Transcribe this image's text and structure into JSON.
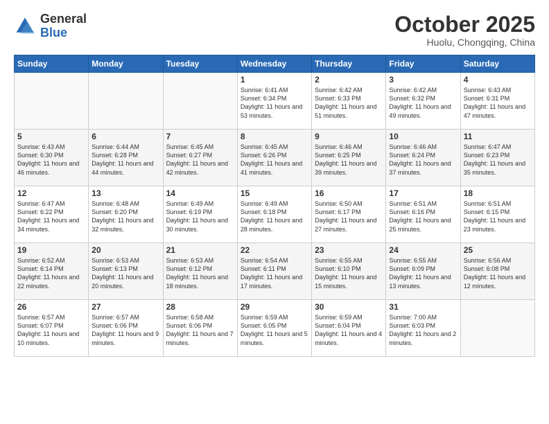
{
  "header": {
    "logo_general": "General",
    "logo_blue": "Blue",
    "month": "October 2025",
    "location": "Huolu, Chongqing, China"
  },
  "days_of_week": [
    "Sunday",
    "Monday",
    "Tuesday",
    "Wednesday",
    "Thursday",
    "Friday",
    "Saturday"
  ],
  "weeks": [
    [
      {
        "day": "",
        "info": ""
      },
      {
        "day": "",
        "info": ""
      },
      {
        "day": "",
        "info": ""
      },
      {
        "day": "1",
        "info": "Sunrise: 6:41 AM\nSunset: 6:34 PM\nDaylight: 11 hours and 53 minutes."
      },
      {
        "day": "2",
        "info": "Sunrise: 6:42 AM\nSunset: 6:33 PM\nDaylight: 11 hours and 51 minutes."
      },
      {
        "day": "3",
        "info": "Sunrise: 6:42 AM\nSunset: 6:32 PM\nDaylight: 11 hours and 49 minutes."
      },
      {
        "day": "4",
        "info": "Sunrise: 6:43 AM\nSunset: 6:31 PM\nDaylight: 11 hours and 47 minutes."
      }
    ],
    [
      {
        "day": "5",
        "info": "Sunrise: 6:43 AM\nSunset: 6:30 PM\nDaylight: 11 hours and 46 minutes."
      },
      {
        "day": "6",
        "info": "Sunrise: 6:44 AM\nSunset: 6:28 PM\nDaylight: 11 hours and 44 minutes."
      },
      {
        "day": "7",
        "info": "Sunrise: 6:45 AM\nSunset: 6:27 PM\nDaylight: 11 hours and 42 minutes."
      },
      {
        "day": "8",
        "info": "Sunrise: 6:45 AM\nSunset: 6:26 PM\nDaylight: 11 hours and 41 minutes."
      },
      {
        "day": "9",
        "info": "Sunrise: 6:46 AM\nSunset: 6:25 PM\nDaylight: 11 hours and 39 minutes."
      },
      {
        "day": "10",
        "info": "Sunrise: 6:46 AM\nSunset: 6:24 PM\nDaylight: 11 hours and 37 minutes."
      },
      {
        "day": "11",
        "info": "Sunrise: 6:47 AM\nSunset: 6:23 PM\nDaylight: 11 hours and 35 minutes."
      }
    ],
    [
      {
        "day": "12",
        "info": "Sunrise: 6:47 AM\nSunset: 6:22 PM\nDaylight: 11 hours and 34 minutes."
      },
      {
        "day": "13",
        "info": "Sunrise: 6:48 AM\nSunset: 6:20 PM\nDaylight: 11 hours and 32 minutes."
      },
      {
        "day": "14",
        "info": "Sunrise: 6:49 AM\nSunset: 6:19 PM\nDaylight: 11 hours and 30 minutes."
      },
      {
        "day": "15",
        "info": "Sunrise: 6:49 AM\nSunset: 6:18 PM\nDaylight: 11 hours and 28 minutes."
      },
      {
        "day": "16",
        "info": "Sunrise: 6:50 AM\nSunset: 6:17 PM\nDaylight: 11 hours and 27 minutes."
      },
      {
        "day": "17",
        "info": "Sunrise: 6:51 AM\nSunset: 6:16 PM\nDaylight: 11 hours and 25 minutes."
      },
      {
        "day": "18",
        "info": "Sunrise: 6:51 AM\nSunset: 6:15 PM\nDaylight: 11 hours and 23 minutes."
      }
    ],
    [
      {
        "day": "19",
        "info": "Sunrise: 6:52 AM\nSunset: 6:14 PM\nDaylight: 11 hours and 22 minutes."
      },
      {
        "day": "20",
        "info": "Sunrise: 6:53 AM\nSunset: 6:13 PM\nDaylight: 11 hours and 20 minutes."
      },
      {
        "day": "21",
        "info": "Sunrise: 6:53 AM\nSunset: 6:12 PM\nDaylight: 11 hours and 18 minutes."
      },
      {
        "day": "22",
        "info": "Sunrise: 6:54 AM\nSunset: 6:11 PM\nDaylight: 11 hours and 17 minutes."
      },
      {
        "day": "23",
        "info": "Sunrise: 6:55 AM\nSunset: 6:10 PM\nDaylight: 11 hours and 15 minutes."
      },
      {
        "day": "24",
        "info": "Sunrise: 6:55 AM\nSunset: 6:09 PM\nDaylight: 11 hours and 13 minutes."
      },
      {
        "day": "25",
        "info": "Sunrise: 6:56 AM\nSunset: 6:08 PM\nDaylight: 11 hours and 12 minutes."
      }
    ],
    [
      {
        "day": "26",
        "info": "Sunrise: 6:57 AM\nSunset: 6:07 PM\nDaylight: 11 hours and 10 minutes."
      },
      {
        "day": "27",
        "info": "Sunrise: 6:57 AM\nSunset: 6:06 PM\nDaylight: 11 hours and 9 minutes."
      },
      {
        "day": "28",
        "info": "Sunrise: 6:58 AM\nSunset: 6:06 PM\nDaylight: 11 hours and 7 minutes."
      },
      {
        "day": "29",
        "info": "Sunrise: 6:59 AM\nSunset: 6:05 PM\nDaylight: 11 hours and 5 minutes."
      },
      {
        "day": "30",
        "info": "Sunrise: 6:59 AM\nSunset: 6:04 PM\nDaylight: 11 hours and 4 minutes."
      },
      {
        "day": "31",
        "info": "Sunrise: 7:00 AM\nSunset: 6:03 PM\nDaylight: 11 hours and 2 minutes."
      },
      {
        "day": "",
        "info": ""
      }
    ]
  ]
}
